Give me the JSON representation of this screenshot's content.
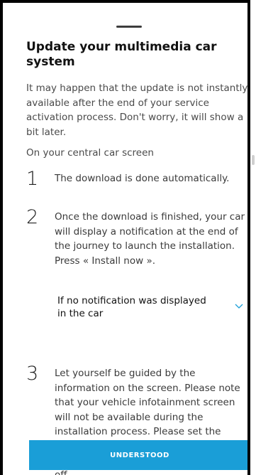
{
  "sheet": {
    "title": "Update your multimedia car system",
    "intro": "It may happen that the update is not instantly available after the end of your service activation process. Don't worry, it will show a bit later.",
    "subtitle": "On your central car screen"
  },
  "steps": [
    {
      "number": "1",
      "text": "The download is done automatically."
    },
    {
      "number": "2",
      "text": "Once the download is finished, your car will display a notification at the end of the journey to launch the installation. Press « Install now »."
    },
    {
      "number": "3",
      "text": "Let yourself be guided by the information on the screen. Please note that your vehicle infotainment screen will not be available during the installation process. Please set the climate control before installation"
    }
  ],
  "accordion": {
    "label": "If no notification was displayed in the car",
    "expanded": false
  },
  "cta": {
    "label": "UNDERSTOOD"
  },
  "trailing_text": "off.",
  "colors": {
    "accent": "#1a9ed7",
    "title": "#111111",
    "body": "#4a4a4a"
  }
}
